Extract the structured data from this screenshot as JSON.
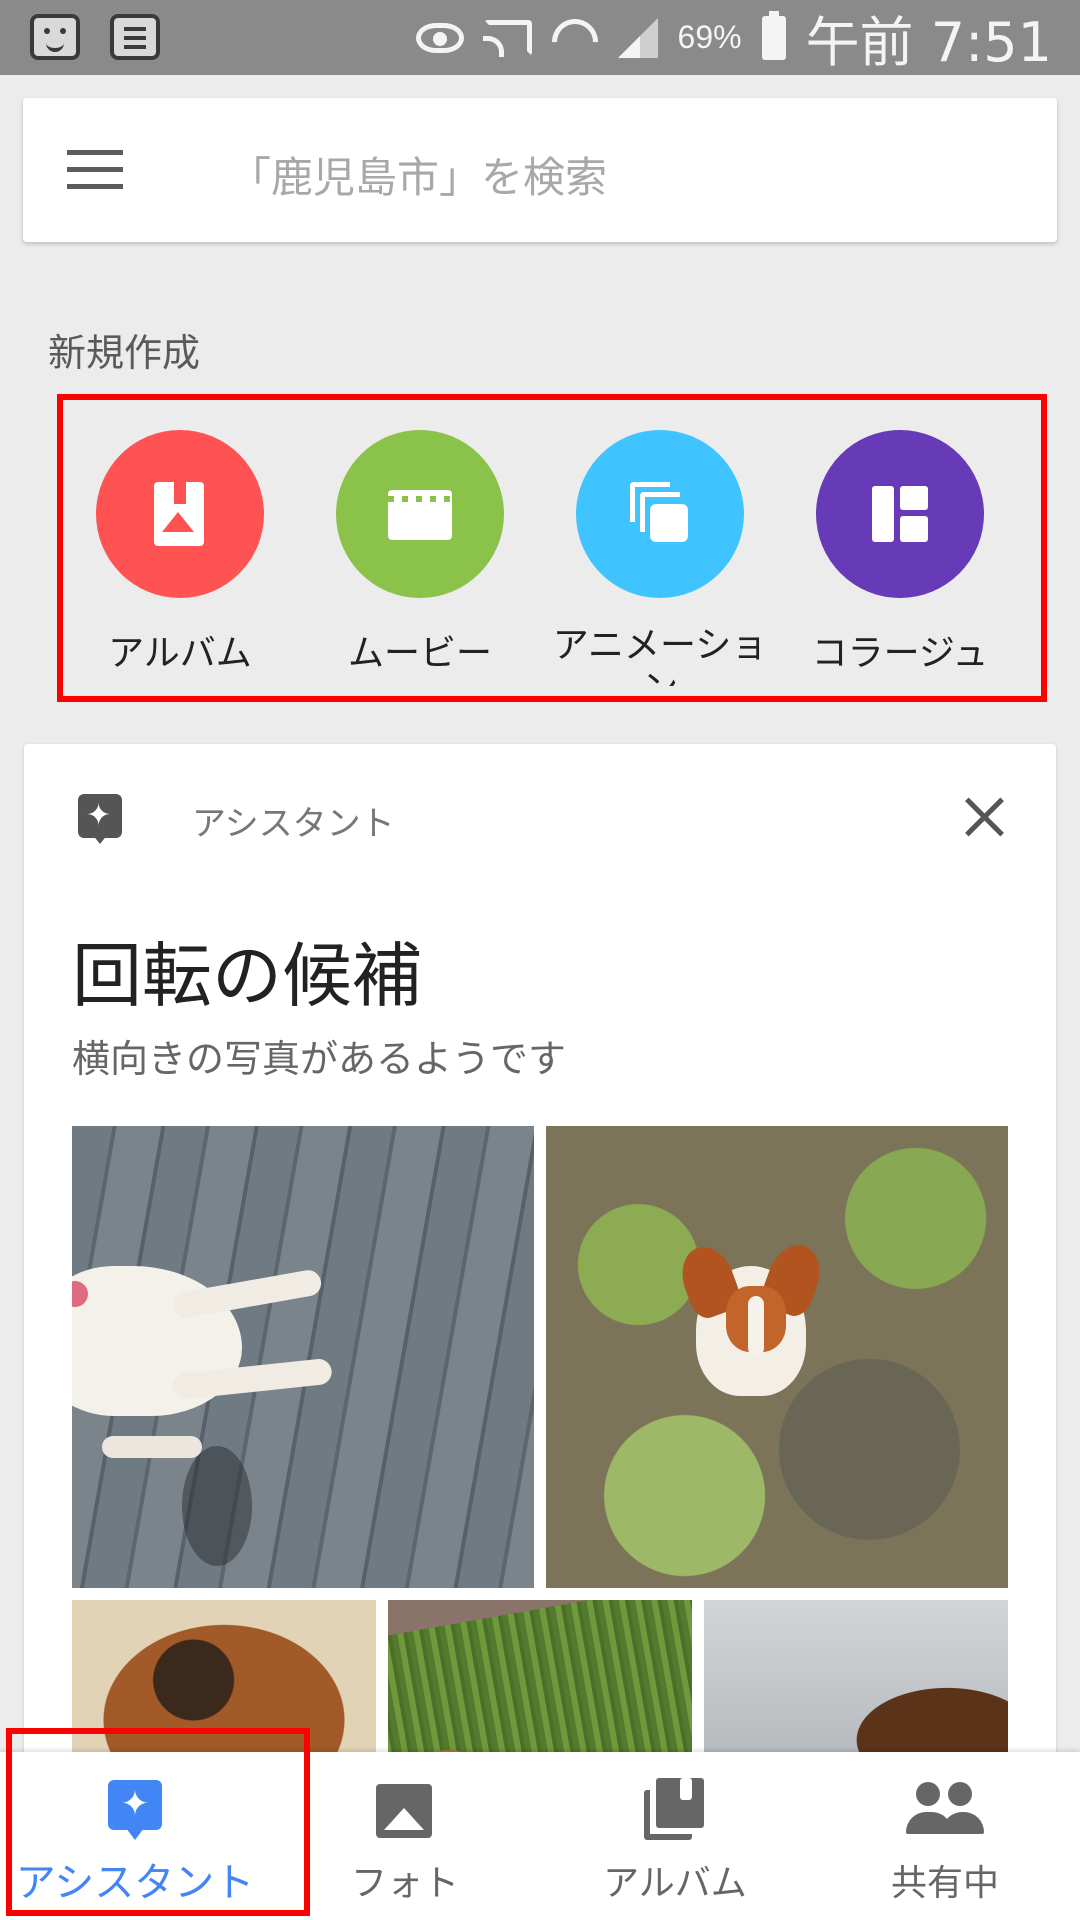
{
  "status_bar": {
    "battery_percent": "69%",
    "time": "午前 7:51"
  },
  "search": {
    "placeholder": "「鹿児島市」を検索"
  },
  "create": {
    "title": "新規作成",
    "items": [
      {
        "label": "アルバム",
        "icon": "album-icon",
        "color": "#ff5252"
      },
      {
        "label": "ムービー",
        "icon": "movie-icon",
        "color": "#8bc34a"
      },
      {
        "label": "アニメーション",
        "icon": "animation-icon",
        "color": "#40c4ff"
      },
      {
        "label": "コラージュ",
        "icon": "collage-icon",
        "color": "#673ab7"
      }
    ]
  },
  "assistant_card": {
    "header_label": "アシスタント",
    "title": "回転の候補",
    "subtitle": "横向きの写真があるようです"
  },
  "bottom_nav": {
    "items": [
      {
        "label": "アシスタント",
        "icon": "assistant-icon",
        "active": true
      },
      {
        "label": "フォト",
        "icon": "photo-icon",
        "active": false
      },
      {
        "label": "アルバム",
        "icon": "album-icon",
        "active": false
      },
      {
        "label": "共有中",
        "icon": "people-icon",
        "active": false
      }
    ]
  },
  "colors": {
    "accent": "#4285f4",
    "highlight": "#ff0000"
  }
}
